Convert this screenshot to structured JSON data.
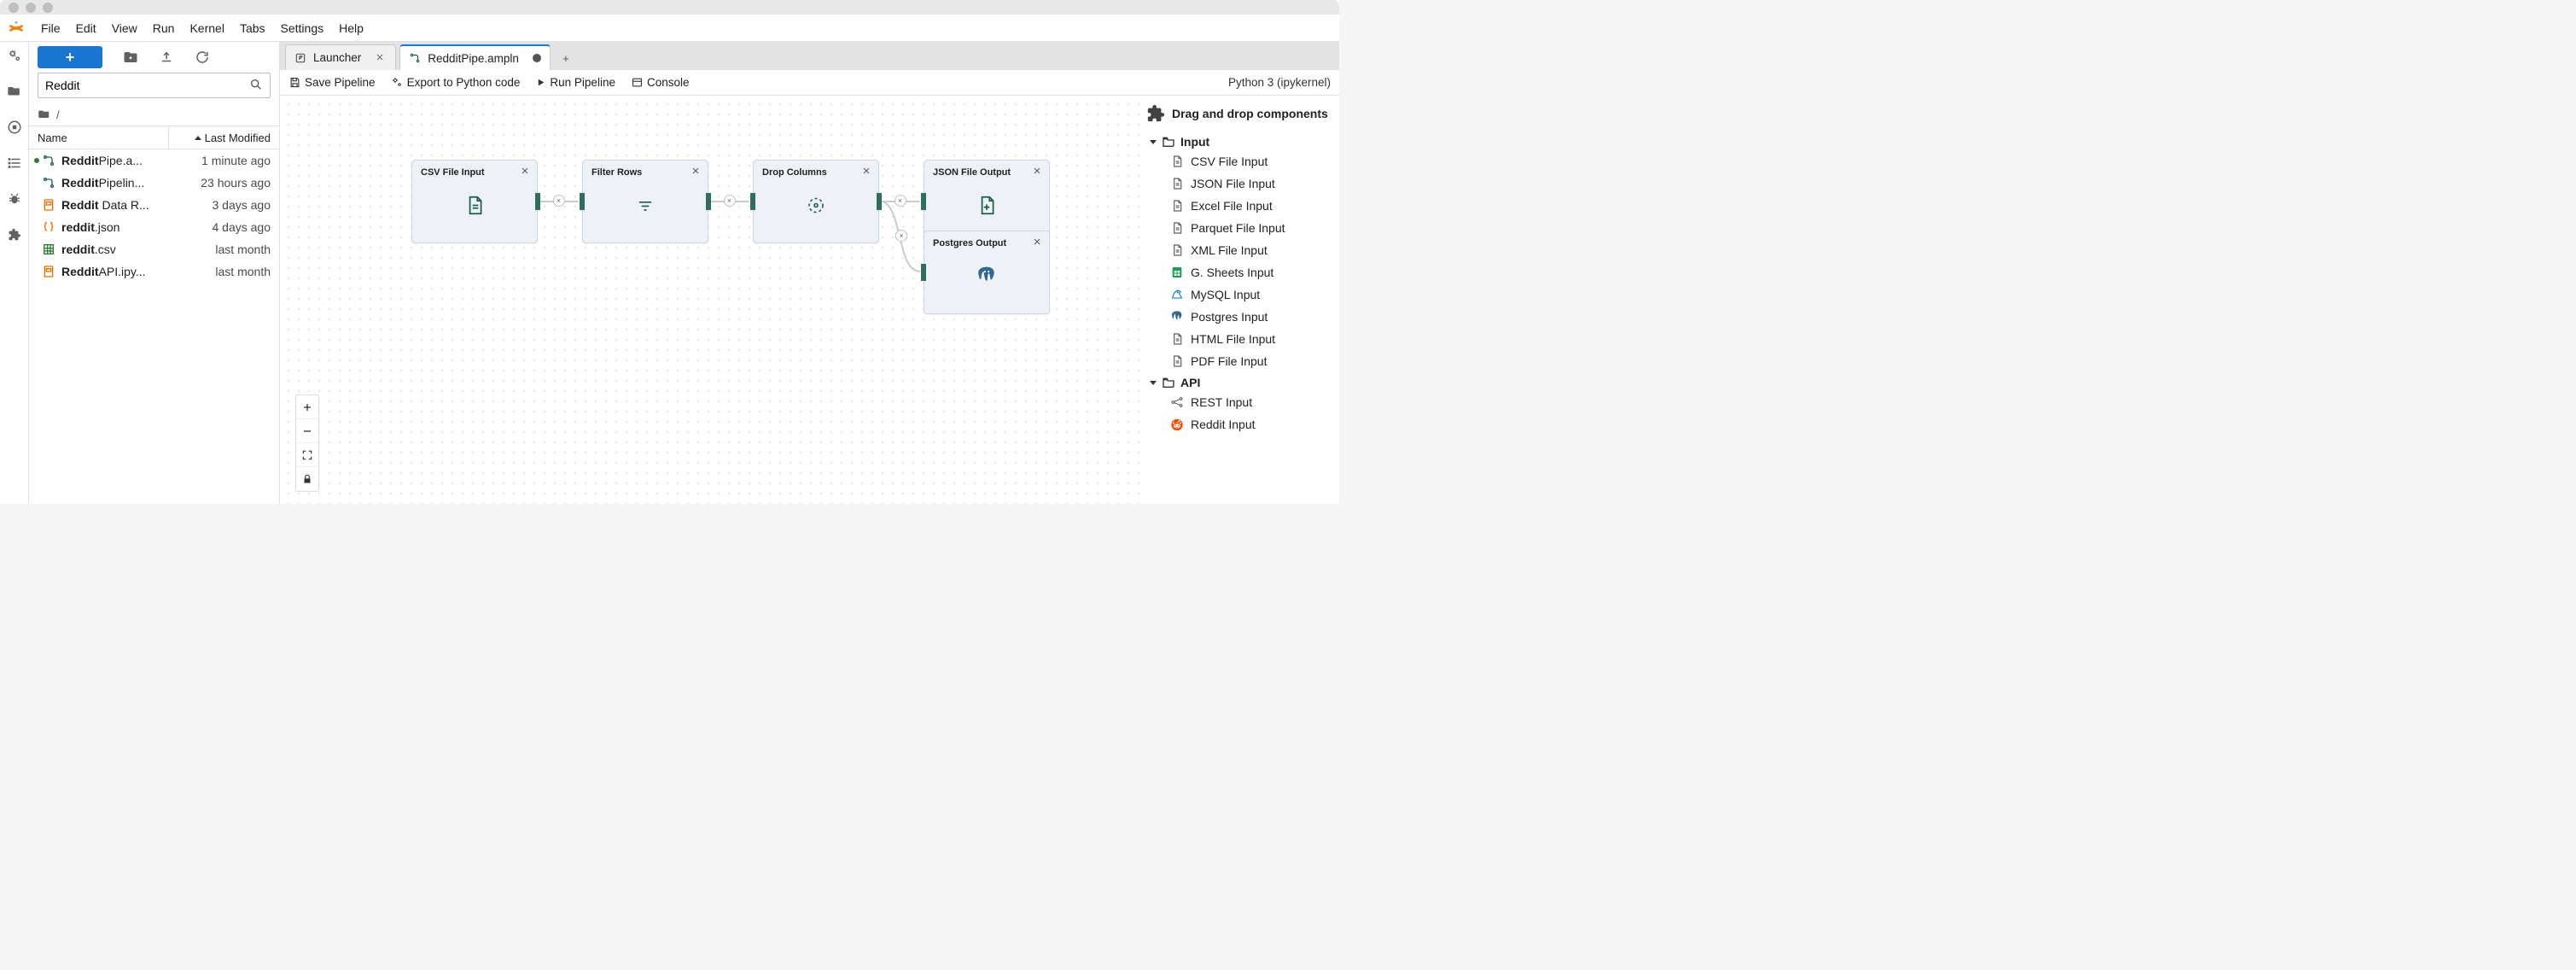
{
  "menu": {
    "items": [
      "File",
      "Edit",
      "View",
      "Run",
      "Kernel",
      "Tabs",
      "Settings",
      "Help"
    ]
  },
  "sidebar_filter": {
    "value": "Reddit"
  },
  "breadcrumb": {
    "path": "/"
  },
  "filebrowser": {
    "columns": {
      "name": "Name",
      "modified": "Last Modified"
    },
    "rows": [
      {
        "bold": "Reddit",
        "rest": "Pipe.a...",
        "modified": "1 minute ago",
        "icon": "pipeline",
        "running": true
      },
      {
        "bold": "Reddit",
        "rest": "Pipelin...",
        "modified": "23 hours ago",
        "icon": "pipeline",
        "running": false
      },
      {
        "bold": "Reddit",
        "rest": " Data R...",
        "modified": "3 days ago",
        "icon": "notebook",
        "running": false
      },
      {
        "bold": "reddit",
        "rest": ".json",
        "modified": "4 days ago",
        "icon": "json",
        "running": false
      },
      {
        "bold": "reddit",
        "rest": ".csv",
        "modified": "last month",
        "icon": "csv",
        "running": false
      },
      {
        "bold": "Reddit",
        "rest": "API.ipy...",
        "modified": "last month",
        "icon": "notebook",
        "running": false
      }
    ]
  },
  "tabs": {
    "launcher": "Launcher",
    "active": "RedditPipe.ampln"
  },
  "toolbar": {
    "save": "Save Pipeline",
    "export": "Export to Python code",
    "run": "Run Pipeline",
    "console": "Console",
    "kernel": "Python 3 (ipykernel)"
  },
  "canvas": {
    "nodes": {
      "csv": "CSV File Input",
      "filter": "Filter Rows",
      "drop": "Drop Columns",
      "json": "JSON File Output",
      "postgres": "Postgres Output"
    }
  },
  "components": {
    "title": "Drag and drop components",
    "groups": [
      {
        "name": "Input",
        "items": [
          {
            "label": "CSV File Input",
            "icon": "doc"
          },
          {
            "label": "JSON File Input",
            "icon": "doc"
          },
          {
            "label": "Excel File Input",
            "icon": "doc"
          },
          {
            "label": "Parquet File Input",
            "icon": "doc"
          },
          {
            "label": "XML File Input",
            "icon": "doc"
          },
          {
            "label": "G. Sheets Input",
            "icon": "sheets"
          },
          {
            "label": "MySQL Input",
            "icon": "mysql"
          },
          {
            "label": "Postgres Input",
            "icon": "postgres"
          },
          {
            "label": "HTML File Input",
            "icon": "doc"
          },
          {
            "label": "PDF File Input",
            "icon": "doc"
          }
        ]
      },
      {
        "name": "API",
        "items": [
          {
            "label": "REST Input",
            "icon": "rest"
          },
          {
            "label": "Reddit Input",
            "icon": "reddit"
          }
        ]
      }
    ]
  }
}
